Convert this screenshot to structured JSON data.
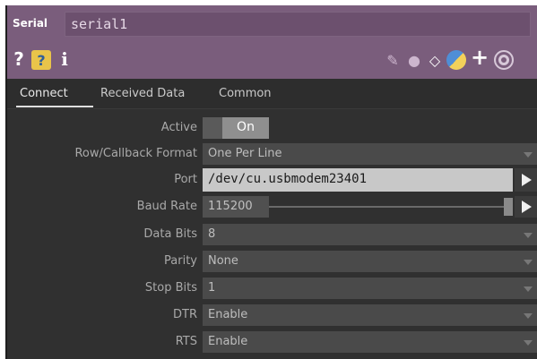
{
  "header": {
    "op_type": "Serial",
    "op_name": "serial1",
    "icons": [
      "help-icon",
      "python-help-icon",
      "info-icon",
      "pencil-icon",
      "comment-icon",
      "clone-icon",
      "python-icon",
      "plus-icon",
      "viewer-target-icon"
    ],
    "colors": {
      "header_bg": "#7a5d7c",
      "name_field_bg": "#6c506e"
    }
  },
  "tabs": [
    {
      "label": "Connect",
      "active": true
    },
    {
      "label": "Received Data",
      "active": false
    },
    {
      "label": "Common",
      "active": false
    }
  ],
  "params": {
    "active": {
      "label": "Active",
      "value": "On"
    },
    "format": {
      "label": "Row/Callback Format",
      "value": "One Per Line"
    },
    "port": {
      "label": "Port",
      "value": "/dev/cu.usbmodem23401"
    },
    "baud": {
      "label": "Baud Rate",
      "value": "115200"
    },
    "databits": {
      "label": "Data Bits",
      "value": "8"
    },
    "parity": {
      "label": "Parity",
      "value": "None"
    },
    "stopbits": {
      "label": "Stop Bits",
      "value": "1"
    },
    "dtr": {
      "label": "DTR",
      "value": "Enable"
    },
    "rts": {
      "label": "RTS",
      "value": "Enable"
    }
  },
  "help_glyphs": {
    "question": "?",
    "info": "i"
  }
}
